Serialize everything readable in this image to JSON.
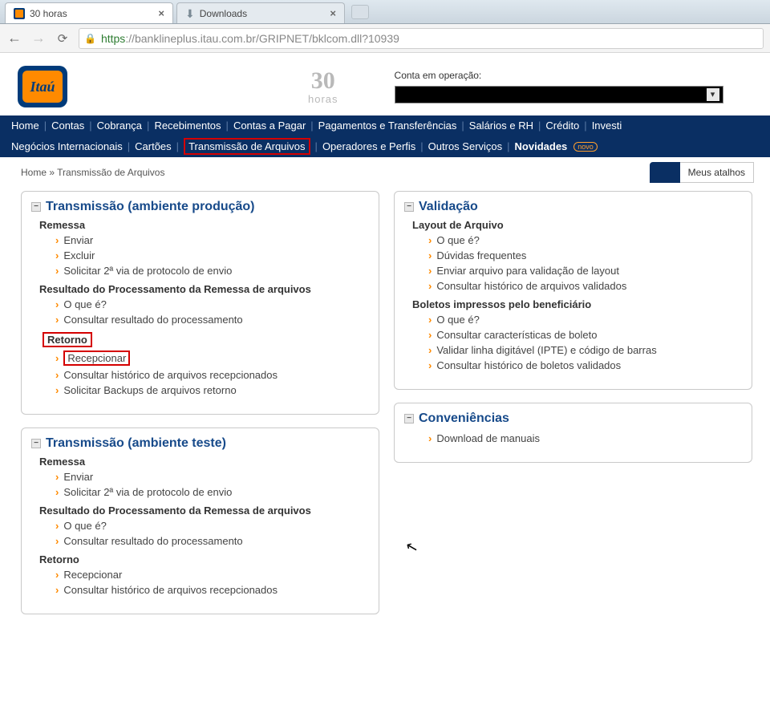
{
  "browser": {
    "tabs": [
      {
        "title": "30 horas"
      },
      {
        "title": "Downloads"
      }
    ],
    "url_https": "https",
    "url_host": "://banklineplus.itau.com.br",
    "url_path": "/GRIPNET/bklcom.dll?10939"
  },
  "header": {
    "logo_text": "Itaú",
    "thirty": "30",
    "horas": "horas",
    "conta_label": "Conta em operação:"
  },
  "nav": {
    "row1": [
      "Home",
      "Contas",
      "Cobrança",
      "Recebimentos",
      "Contas a Pagar",
      "Pagamentos e Transferências",
      "Salários e RH",
      "Crédito",
      "Investi"
    ],
    "row2_pre": [
      "Negócios Internacionais",
      "Cartões"
    ],
    "row2_hl": "Transmissão de Arquivos",
    "row2_post": [
      "Operadores e Perfis",
      "Outros Serviços"
    ],
    "novidades": "Novidades",
    "novo": "novo"
  },
  "crumb": {
    "home": "Home",
    "sep": "»",
    "current": "Transmissão de Arquivos"
  },
  "shortcuts_label": "Meus atalhos",
  "panels": {
    "p1": {
      "title": "Transmissão (ambiente produção)",
      "g1": {
        "head": "Remessa",
        "items": [
          "Enviar",
          "Excluir",
          "Solicitar 2ª via de protocolo de envio"
        ]
      },
      "g2": {
        "head": "Resultado do Processamento da Remessa de arquivos",
        "items": [
          "O que é?",
          "Consultar resultado do processamento"
        ]
      },
      "g3": {
        "head": "Retorno",
        "items": [
          "Recepcionar",
          "Consultar histórico de arquivos recepcionados",
          "Solicitar Backups de arquivos retorno"
        ]
      }
    },
    "p2": {
      "title": "Transmissão (ambiente teste)",
      "g1": {
        "head": "Remessa",
        "items": [
          "Enviar",
          "Solicitar 2ª via de protocolo de envio"
        ]
      },
      "g2": {
        "head": "Resultado do Processamento da Remessa de arquivos",
        "items": [
          "O que é?",
          "Consultar resultado do processamento"
        ]
      },
      "g3": {
        "head": "Retorno",
        "items": [
          "Recepcionar",
          "Consultar histórico de arquivos recepcionados"
        ]
      }
    },
    "p3": {
      "title": "Validação",
      "g1": {
        "head": "Layout de Arquivo",
        "items": [
          "O que é?",
          "Dúvidas frequentes",
          "Enviar arquivo para validação de layout",
          "Consultar histórico de arquivos validados"
        ]
      },
      "g2": {
        "head": "Boletos impressos pelo beneficiário",
        "items": [
          "O que é?",
          "Consultar características de boleto",
          "Validar linha digitável (IPTE) e código de barras",
          "Consultar histórico de boletos validados"
        ]
      }
    },
    "p4": {
      "title": "Conveniências",
      "g1": {
        "items": [
          "Download de manuais"
        ]
      }
    }
  }
}
